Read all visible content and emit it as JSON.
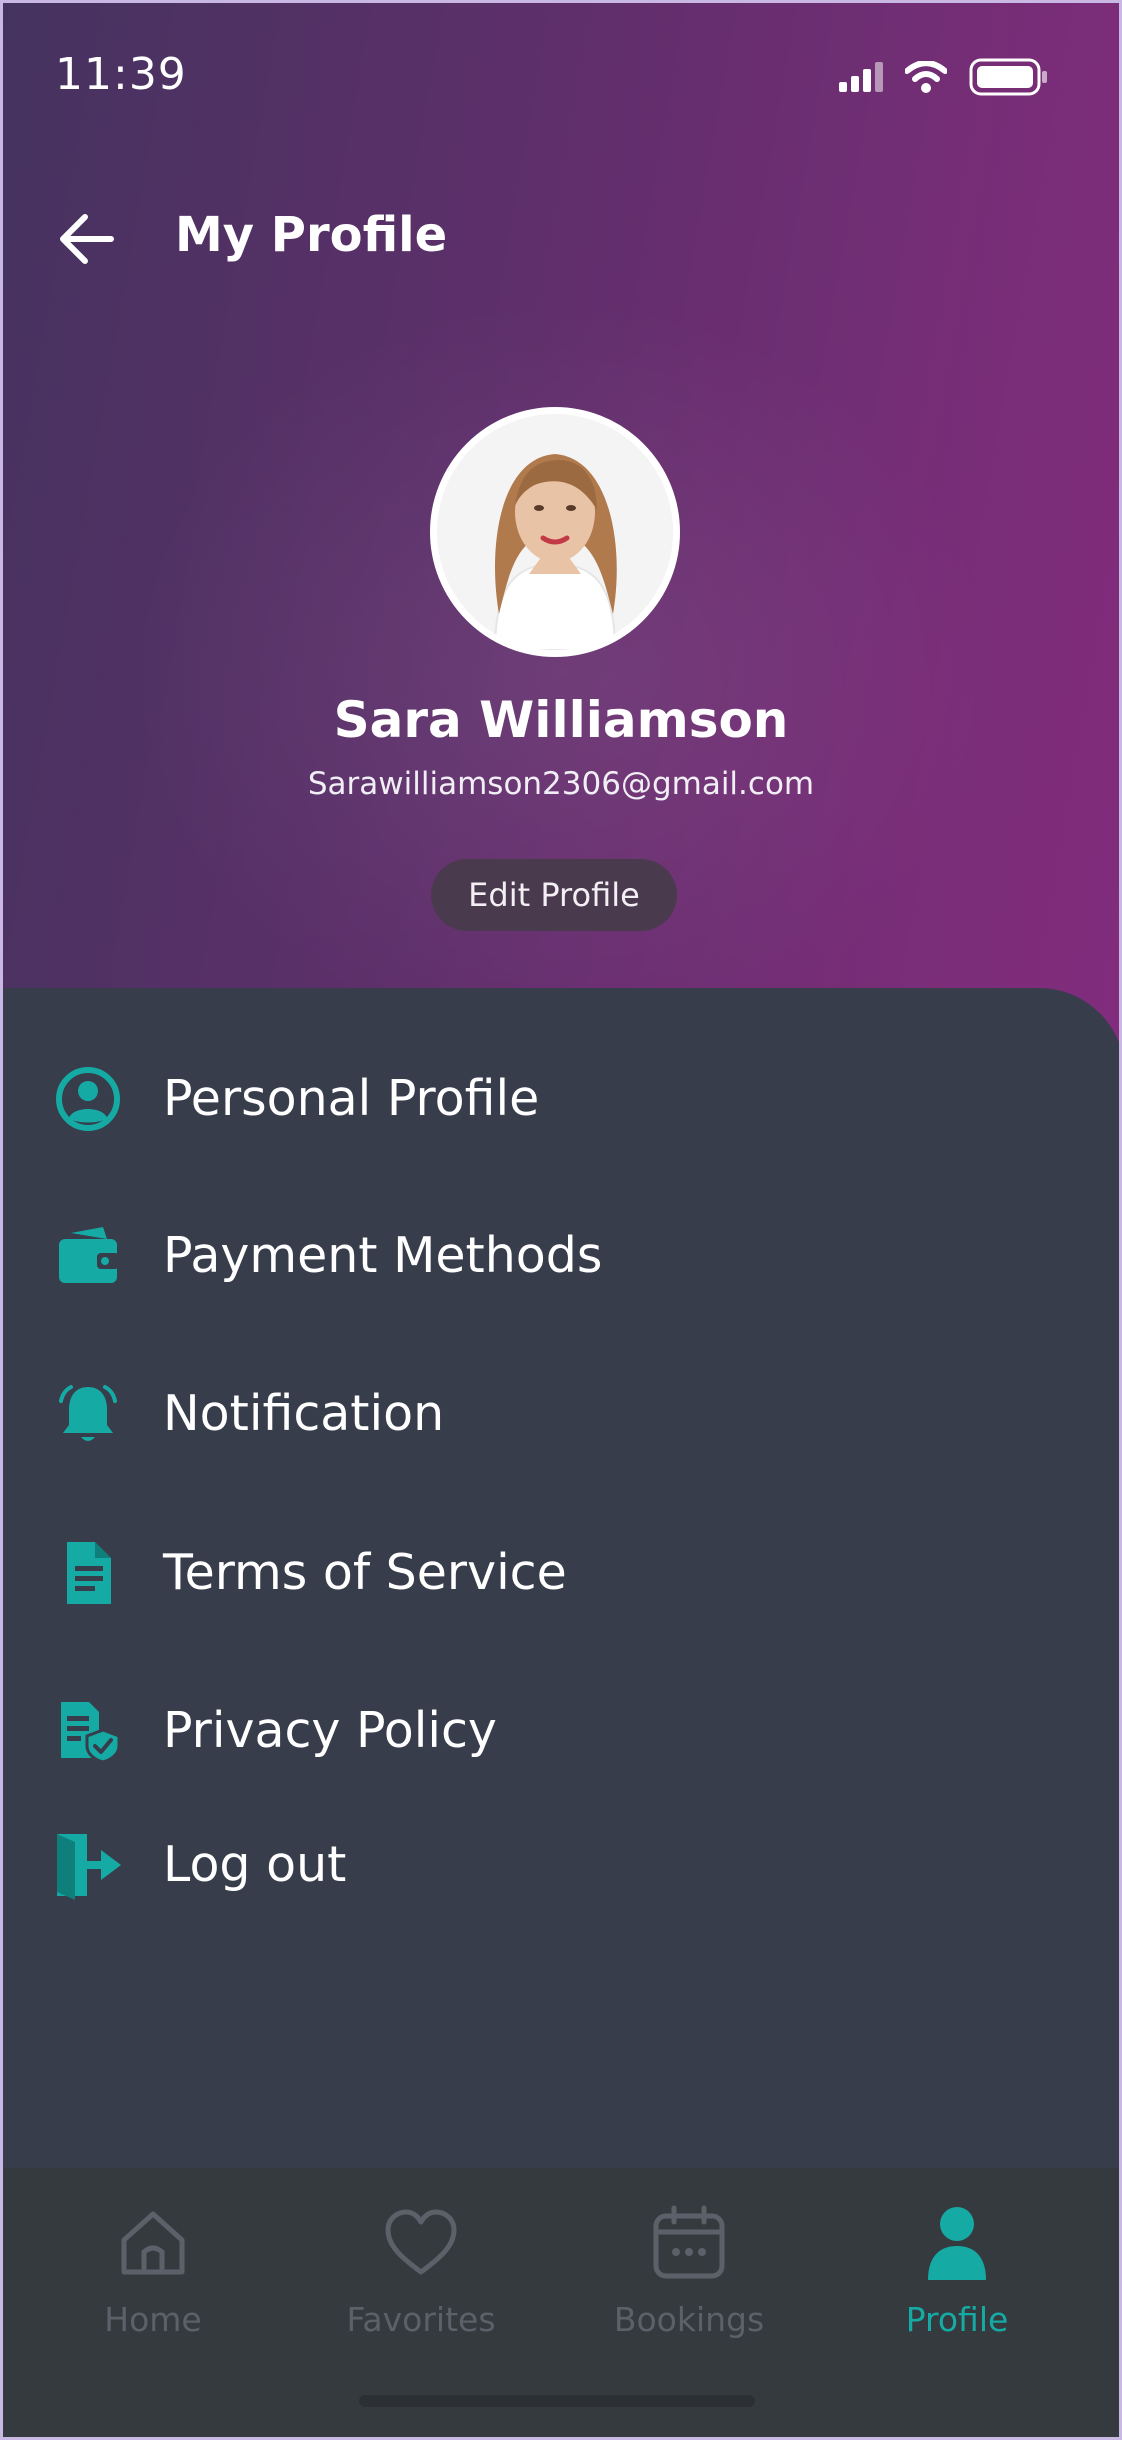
{
  "status_bar": {
    "time": "11:39"
  },
  "header": {
    "title": "My Profile"
  },
  "profile": {
    "name": "Sara Williamson",
    "email": "Sarawilliamson2306@gmail.com",
    "edit_label": "Edit Profile"
  },
  "menu": {
    "items": [
      {
        "label": "Personal Profile",
        "icon": "user-circle-icon"
      },
      {
        "label": "Payment Methods",
        "icon": "wallet-icon"
      },
      {
        "label": "Notification",
        "icon": "bell-icon"
      },
      {
        "label": "Terms of Service",
        "icon": "document-icon"
      },
      {
        "label": "Privacy Policy",
        "icon": "document-shield-icon"
      },
      {
        "label": "Log out",
        "icon": "logout-icon"
      }
    ]
  },
  "tab_bar": {
    "tabs": [
      {
        "label": "Home",
        "icon": "home-icon",
        "active": false
      },
      {
        "label": "Favorites",
        "icon": "heart-icon",
        "active": false
      },
      {
        "label": "Bookings",
        "icon": "calendar-icon",
        "active": false
      },
      {
        "label": "Profile",
        "icon": "person-icon",
        "active": true
      }
    ]
  },
  "colors": {
    "accent": "#16aaa5",
    "panel": "#373d4b",
    "tab_bar": "#353a3f",
    "inactive_tab": "#5b6168",
    "header_gradient_start": "#45335f",
    "header_gradient_end": "#8a2b82"
  }
}
